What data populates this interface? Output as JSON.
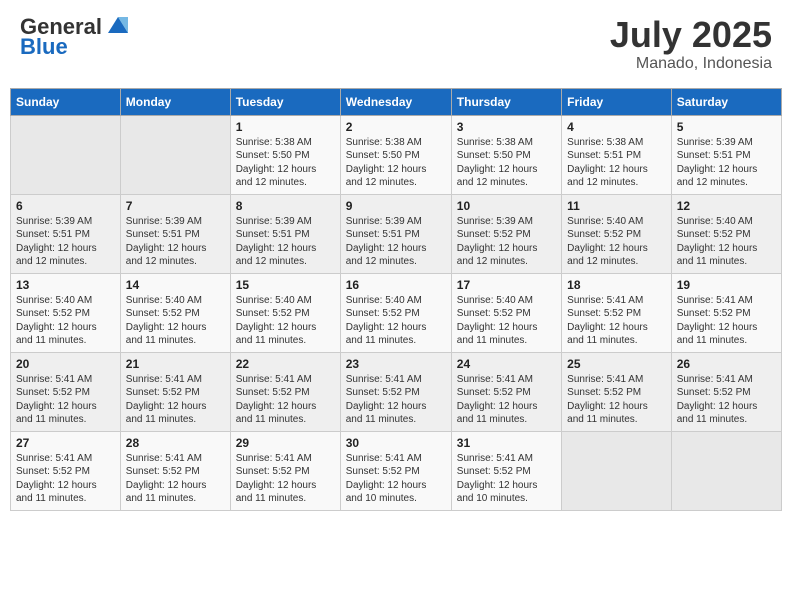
{
  "logo": {
    "general": "General",
    "blue": "Blue"
  },
  "title": {
    "month": "July 2025",
    "location": "Manado, Indonesia"
  },
  "headers": [
    "Sunday",
    "Monday",
    "Tuesday",
    "Wednesday",
    "Thursday",
    "Friday",
    "Saturday"
  ],
  "weeks": [
    [
      {
        "day": "",
        "detail": ""
      },
      {
        "day": "",
        "detail": ""
      },
      {
        "day": "1",
        "detail": "Sunrise: 5:38 AM\nSunset: 5:50 PM\nDaylight: 12 hours and 12 minutes."
      },
      {
        "day": "2",
        "detail": "Sunrise: 5:38 AM\nSunset: 5:50 PM\nDaylight: 12 hours and 12 minutes."
      },
      {
        "day": "3",
        "detail": "Sunrise: 5:38 AM\nSunset: 5:50 PM\nDaylight: 12 hours and 12 minutes."
      },
      {
        "day": "4",
        "detail": "Sunrise: 5:38 AM\nSunset: 5:51 PM\nDaylight: 12 hours and 12 minutes."
      },
      {
        "day": "5",
        "detail": "Sunrise: 5:39 AM\nSunset: 5:51 PM\nDaylight: 12 hours and 12 minutes."
      }
    ],
    [
      {
        "day": "6",
        "detail": "Sunrise: 5:39 AM\nSunset: 5:51 PM\nDaylight: 12 hours and 12 minutes."
      },
      {
        "day": "7",
        "detail": "Sunrise: 5:39 AM\nSunset: 5:51 PM\nDaylight: 12 hours and 12 minutes."
      },
      {
        "day": "8",
        "detail": "Sunrise: 5:39 AM\nSunset: 5:51 PM\nDaylight: 12 hours and 12 minutes."
      },
      {
        "day": "9",
        "detail": "Sunrise: 5:39 AM\nSunset: 5:51 PM\nDaylight: 12 hours and 12 minutes."
      },
      {
        "day": "10",
        "detail": "Sunrise: 5:39 AM\nSunset: 5:52 PM\nDaylight: 12 hours and 12 minutes."
      },
      {
        "day": "11",
        "detail": "Sunrise: 5:40 AM\nSunset: 5:52 PM\nDaylight: 12 hours and 12 minutes."
      },
      {
        "day": "12",
        "detail": "Sunrise: 5:40 AM\nSunset: 5:52 PM\nDaylight: 12 hours and 11 minutes."
      }
    ],
    [
      {
        "day": "13",
        "detail": "Sunrise: 5:40 AM\nSunset: 5:52 PM\nDaylight: 12 hours and 11 minutes."
      },
      {
        "day": "14",
        "detail": "Sunrise: 5:40 AM\nSunset: 5:52 PM\nDaylight: 12 hours and 11 minutes."
      },
      {
        "day": "15",
        "detail": "Sunrise: 5:40 AM\nSunset: 5:52 PM\nDaylight: 12 hours and 11 minutes."
      },
      {
        "day": "16",
        "detail": "Sunrise: 5:40 AM\nSunset: 5:52 PM\nDaylight: 12 hours and 11 minutes."
      },
      {
        "day": "17",
        "detail": "Sunrise: 5:40 AM\nSunset: 5:52 PM\nDaylight: 12 hours and 11 minutes."
      },
      {
        "day": "18",
        "detail": "Sunrise: 5:41 AM\nSunset: 5:52 PM\nDaylight: 12 hours and 11 minutes."
      },
      {
        "day": "19",
        "detail": "Sunrise: 5:41 AM\nSunset: 5:52 PM\nDaylight: 12 hours and 11 minutes."
      }
    ],
    [
      {
        "day": "20",
        "detail": "Sunrise: 5:41 AM\nSunset: 5:52 PM\nDaylight: 12 hours and 11 minutes."
      },
      {
        "day": "21",
        "detail": "Sunrise: 5:41 AM\nSunset: 5:52 PM\nDaylight: 12 hours and 11 minutes."
      },
      {
        "day": "22",
        "detail": "Sunrise: 5:41 AM\nSunset: 5:52 PM\nDaylight: 12 hours and 11 minutes."
      },
      {
        "day": "23",
        "detail": "Sunrise: 5:41 AM\nSunset: 5:52 PM\nDaylight: 12 hours and 11 minutes."
      },
      {
        "day": "24",
        "detail": "Sunrise: 5:41 AM\nSunset: 5:52 PM\nDaylight: 12 hours and 11 minutes."
      },
      {
        "day": "25",
        "detail": "Sunrise: 5:41 AM\nSunset: 5:52 PM\nDaylight: 12 hours and 11 minutes."
      },
      {
        "day": "26",
        "detail": "Sunrise: 5:41 AM\nSunset: 5:52 PM\nDaylight: 12 hours and 11 minutes."
      }
    ],
    [
      {
        "day": "27",
        "detail": "Sunrise: 5:41 AM\nSunset: 5:52 PM\nDaylight: 12 hours and 11 minutes."
      },
      {
        "day": "28",
        "detail": "Sunrise: 5:41 AM\nSunset: 5:52 PM\nDaylight: 12 hours and 11 minutes."
      },
      {
        "day": "29",
        "detail": "Sunrise: 5:41 AM\nSunset: 5:52 PM\nDaylight: 12 hours and 11 minutes."
      },
      {
        "day": "30",
        "detail": "Sunrise: 5:41 AM\nSunset: 5:52 PM\nDaylight: 12 hours and 10 minutes."
      },
      {
        "day": "31",
        "detail": "Sunrise: 5:41 AM\nSunset: 5:52 PM\nDaylight: 12 hours and 10 minutes."
      },
      {
        "day": "",
        "detail": ""
      },
      {
        "day": "",
        "detail": ""
      }
    ]
  ]
}
